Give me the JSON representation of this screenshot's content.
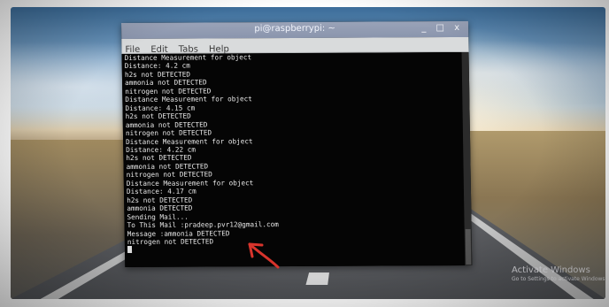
{
  "window": {
    "title": "pi@raspberrypi: ~",
    "controls": [
      "_",
      "□",
      "x"
    ]
  },
  "menu": {
    "items": [
      "File",
      "Edit",
      "Tabs",
      "Help"
    ]
  },
  "console": {
    "lines": [
      "Distance Measurement for object",
      "Distance: 4.2 cm",
      "h2s not DETECTED",
      "ammonia not DETECTED",
      "nitrogen not DETECTED",
      "Distance Measurement for object",
      "Distance: 4.15 cm",
      "h2s not DETECTED",
      "ammonia not DETECTED",
      "nitrogen not DETECTED",
      "Distance Measurement for object",
      "Distance: 4.22 cm",
      "h2s not DETECTED",
      "ammonia not DETECTED",
      "nitrogen not DETECTED",
      "Distance Measurement for object",
      "Distance: 4.17 cm",
      "h2s not DETECTED",
      "ammonia DETECTED",
      "Sending Mail...",
      "To This Mail :pradeep.pvr12@gmail.com",
      "Message :ammonia DETECTED",
      "nitrogen not DETECTED"
    ]
  },
  "watermark": {
    "title": "Activate Windows",
    "subtitle": "Go to Settings to activate Windows."
  },
  "colors": {
    "arrow": "#d8342c",
    "titlebar": "#8f99b0",
    "terminal_bg": "#050505",
    "terminal_fg": "#e8e8e8"
  }
}
